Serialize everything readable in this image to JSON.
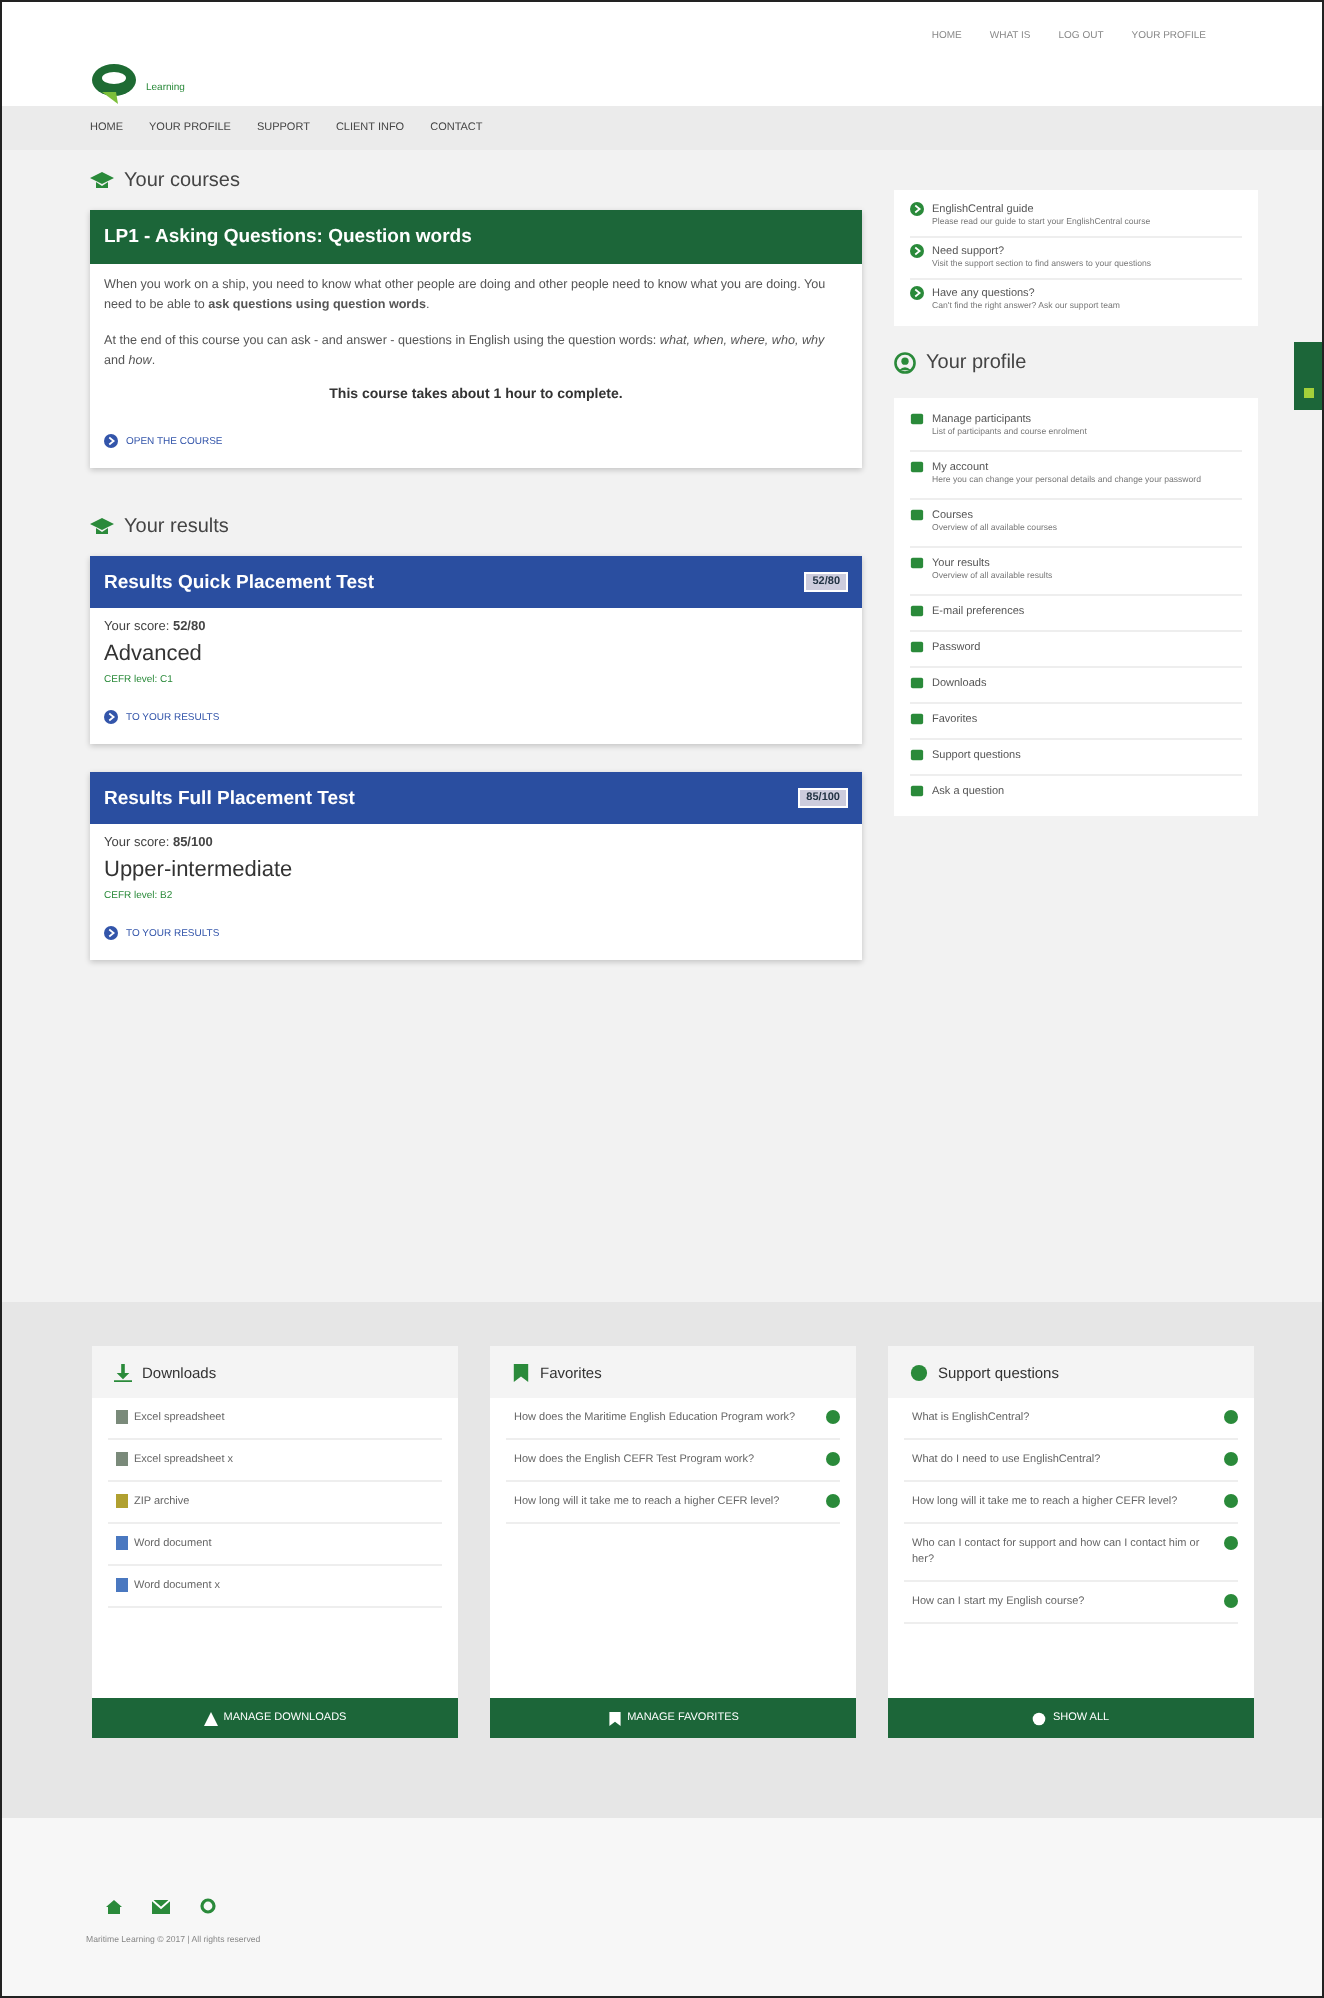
{
  "header": {
    "logo_text": "Learning",
    "top_links": [
      "HOME",
      "WHAT IS",
      "LOG OUT",
      "YOUR PROFILE"
    ]
  },
  "nav": [
    "HOME",
    "YOUR PROFILE",
    "SUPPORT",
    "CLIENT INFO",
    "CONTACT"
  ],
  "courses": {
    "heading": "Your courses",
    "card": {
      "title": "LP1 - Asking Questions: Question words",
      "paragraphs": [
        "When you work on a ship, you need to know what other people are doing and other people need to know what you are doing. You need to be able to **ask questions using question words**.",
        "At the end of this course you can ask - and answer - questions in English using the question words: *what, when, where, who, why* and *how*."
      ],
      "duration": "This course takes about **1 hour** to complete.",
      "link": "OPEN THE COURSE"
    }
  },
  "results": {
    "heading": "Your results",
    "cards": [
      {
        "title": "Results Quick Placement Test",
        "badge": "52/80",
        "score": "Your score: **52/80**",
        "level": "Advanced",
        "cefr": "CEFR level: C1",
        "link": "TO YOUR RESULTS"
      },
      {
        "title": "Results Full Placement Test",
        "badge": "85/100",
        "score": "Your score: **85/100**",
        "level": "Upper-intermediate",
        "cefr": "CEFR level: B2",
        "link": "TO YOUR RESULTS"
      }
    ]
  },
  "info_links": [
    {
      "title": "EnglishCentral guide",
      "desc": "Please read our guide to start your EnglishCentral course"
    },
    {
      "title": "Need support?",
      "desc": "Visit the support section to find answers to your questions"
    },
    {
      "title": "Have any questions?",
      "desc": "Can't find the right answer? Ask our support team"
    }
  ],
  "profile": {
    "heading": "Your profile",
    "items": [
      {
        "label": "Manage participants",
        "desc": "List of participants and course enrolment"
      },
      {
        "label": "My account",
        "desc": "Here you can change your personal details and change your password"
      },
      {
        "label": "Courses",
        "desc": "Overview of all available courses"
      },
      {
        "label": "Your results",
        "desc": "Overview of all available results"
      },
      {
        "label": "E-mail preferences"
      },
      {
        "label": "Password"
      },
      {
        "label": "Downloads"
      },
      {
        "label": "Favorites"
      },
      {
        "label": "Support questions"
      },
      {
        "label": "Ask a question"
      }
    ]
  },
  "panels": [
    {
      "title": "Downloads",
      "items": [
        "Excel spreadsheet",
        "Excel spreadsheet x",
        "ZIP archive",
        "Word document",
        "Word document x"
      ],
      "button": "MANAGE DOWNLOADS"
    },
    {
      "title": "Favorites",
      "items": [
        "How does the Maritime English Education Program work?",
        "How does the English CEFR Test Program work?",
        "How long will it take me to reach a higher CEFR level?"
      ],
      "button": "MANAGE FAVORITES"
    },
    {
      "title": "Support questions",
      "items": [
        "What is EnglishCentral?",
        "What do I need to use EnglishCentral?",
        "How long will it take me to reach a higher CEFR level?",
        "Who can I contact for support and how can I contact him or her?",
        "How can I start my English course?"
      ],
      "button": "SHOW ALL"
    }
  ],
  "footer": {
    "copyright": "Maritime Learning © 2017 | All rights reserved"
  }
}
